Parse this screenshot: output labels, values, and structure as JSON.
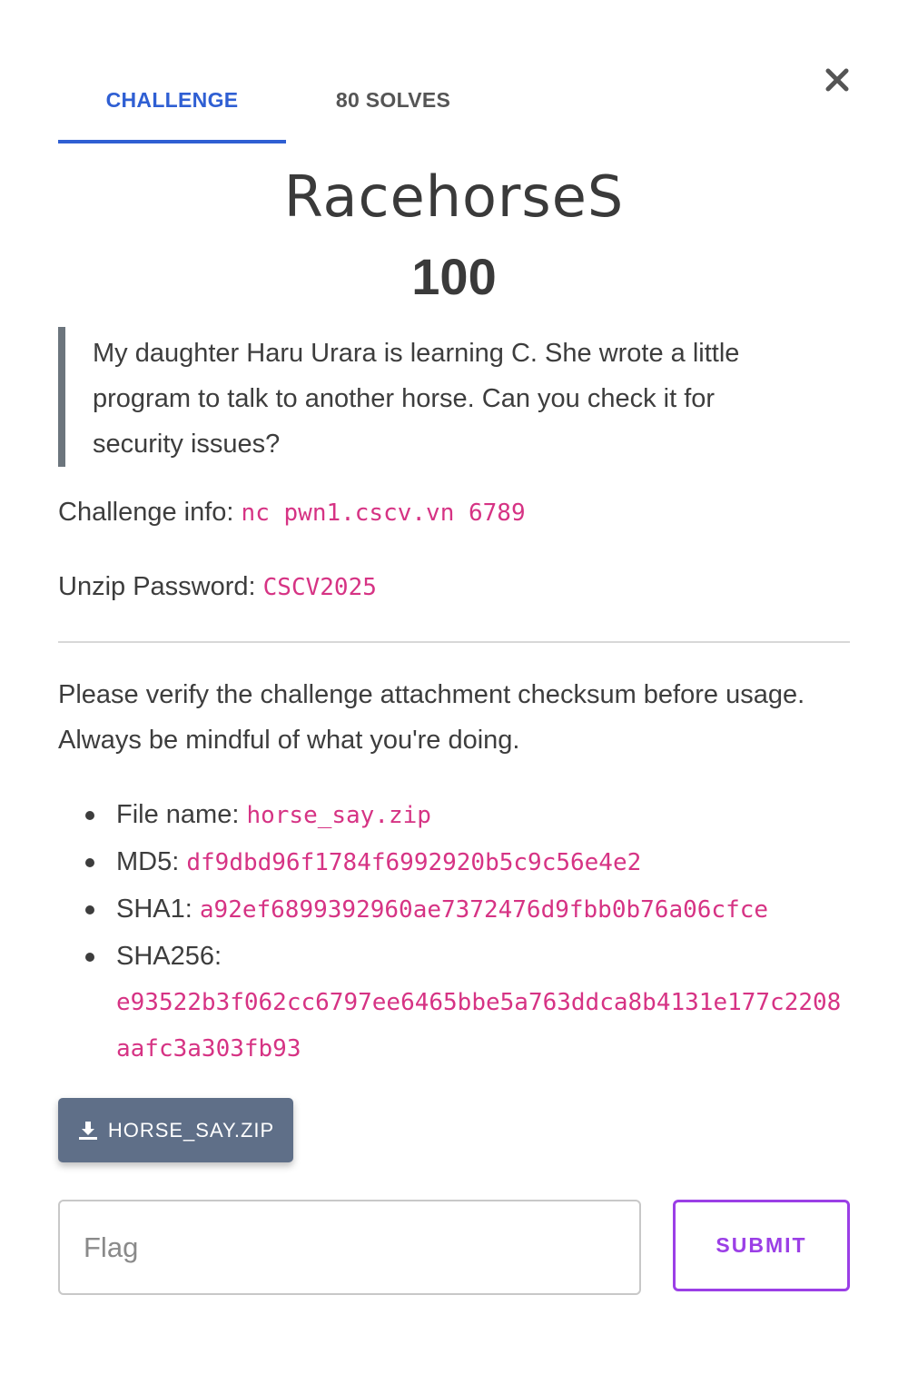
{
  "tabs": {
    "challenge": "CHALLENGE",
    "solves": "80 SOLVES"
  },
  "challenge": {
    "name": "RacehorseS",
    "points": "100",
    "description": "My daughter Haru Urara is learning C. She wrote a little program to talk to another horse. Can you check it for security issues?"
  },
  "info": {
    "challenge_info_label": "Challenge info:",
    "challenge_info_value": "nc pwn1.cscv.vn 6789",
    "unzip_label": "Unzip Password:",
    "unzip_value": "CSCV2025"
  },
  "verify_text": "Please verify the challenge attachment checksum before usage. Always be mindful of what you're doing.",
  "file": {
    "name_label": "File name:",
    "name_value": "horse_say.zip",
    "md5_label": "MD5:",
    "md5_value": "df9dbd96f1784f6992920b5c9c56e4e2",
    "sha1_label": "SHA1:",
    "sha1_value": "a92ef6899392960ae7372476d9fbb0b76a06cfce",
    "sha256_label": "SHA256:",
    "sha256_value": "e93522b3f062cc6797ee6465bbe5a763ddca8b4131e177c2208aafc3a303fb93"
  },
  "download_button": "HORSE_SAY.ZIP",
  "flag_input": {
    "placeholder": "Flag",
    "value": ""
  },
  "submit_button": "SUBMIT",
  "icons": {
    "close": "close-icon",
    "download": "download-icon"
  },
  "colors": {
    "accent_blue": "#2f5fd3",
    "code_pink": "#d63384",
    "submit_purple": "#9b3fe6",
    "download_button": "#5f6f88"
  }
}
